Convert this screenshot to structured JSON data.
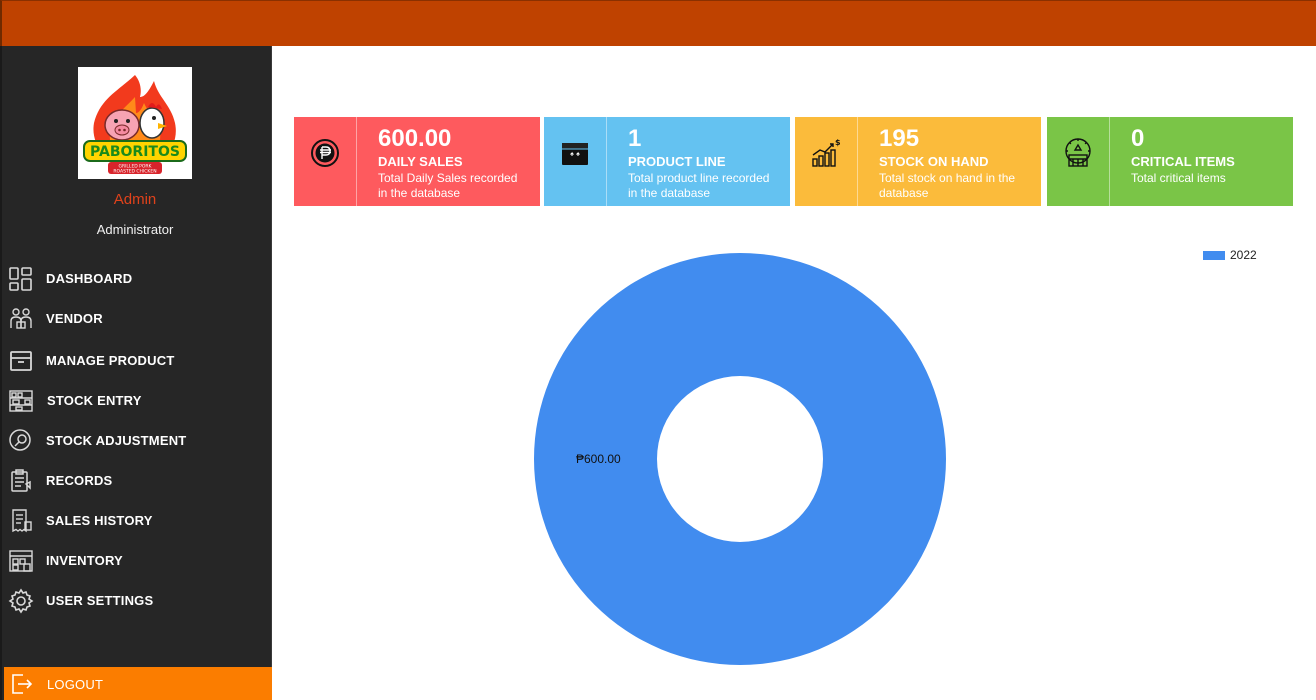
{
  "app": {
    "accent": "#bf4200",
    "sidebar_bg": "#262626",
    "logout_bg": "#fb7d00"
  },
  "logo": {
    "brand": "PABORITOS",
    "tagline1": "GRILLED PORK",
    "tagline2": "ROASTED CHICKEN"
  },
  "user": {
    "name": "Admin",
    "role": "Administrator"
  },
  "nav": [
    {
      "label": "DASHBOARD",
      "icon": "dashboard-grid-icon"
    },
    {
      "label": "VENDOR",
      "icon": "vendor-people-icon"
    },
    {
      "label": "MANAGE PRODUCT",
      "icon": "archive-box-icon"
    },
    {
      "label": "STOCK ENTRY",
      "icon": "shelf-icon"
    },
    {
      "label": "STOCK ADJUSTMENT",
      "icon": "adjust-search-icon"
    },
    {
      "label": "RECORDS",
      "icon": "clipboard-icon"
    },
    {
      "label": "SALES HISTORY",
      "icon": "receipt-icon"
    },
    {
      "label": "INVENTORY",
      "icon": "warehouse-icon"
    },
    {
      "label": "USER SETTINGS",
      "icon": "gear-icon"
    }
  ],
  "logout": {
    "label": "LOGOUT",
    "icon": "logout-icon"
  },
  "cards": [
    {
      "value": "600.00",
      "title": "DAILY SALES",
      "desc": "Total Daily Sales recorded in the database",
      "color": "#fe5a5e",
      "icon": "peso-coin-icon"
    },
    {
      "value": "1",
      "title": "PRODUCT LINE",
      "desc": "Total product line recorded in the database",
      "color": "#64c2f1",
      "icon": "product-box-icon"
    },
    {
      "value": "195",
      "title": "STOCK ON HAND",
      "desc": "Total stock on hand in the database",
      "color": "#fbbb3b",
      "icon": "stock-growth-icon"
    },
    {
      "value": "0",
      "title": "CRITICAL ITEMS",
      "desc": "Total critical items",
      "color": "#7ac547",
      "icon": "critical-warehouse-icon"
    }
  ],
  "chart_data": {
    "type": "pie",
    "donut": true,
    "categories": [
      "2022"
    ],
    "values": [
      600.0
    ],
    "slice_labels": [
      "₱600.00"
    ],
    "colors": [
      "#418cef"
    ],
    "legend": "top-right"
  }
}
